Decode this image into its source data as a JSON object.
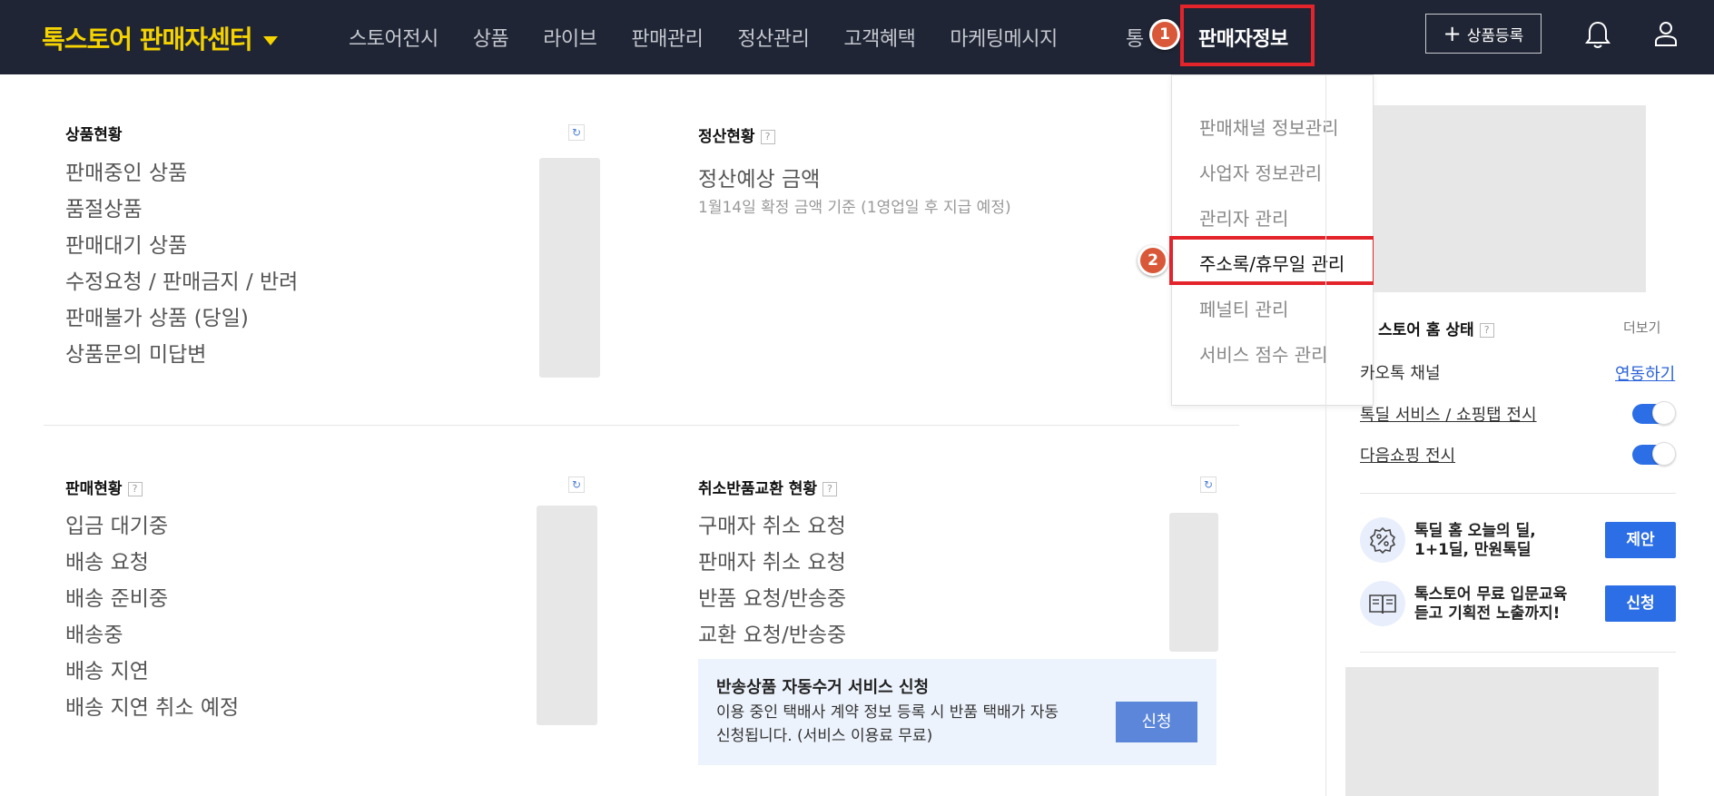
{
  "header": {
    "brand": "톡스토어 판매자센터",
    "nav_items": [
      "스토어전시",
      "상품",
      "라이브",
      "판매관리",
      "정산관리",
      "고객혜택",
      "마케팅메시지"
    ],
    "nav_clipped": "통",
    "active_menu": "판매자정보",
    "register_button": "상품등록",
    "step_badges": [
      "1",
      "2"
    ]
  },
  "dropdown": {
    "items": [
      "판매채널 정보관리",
      "사업자 정보관리",
      "관리자 관리",
      "주소록/휴무일 관리",
      "페널티 관리",
      "서비스 점수 관리"
    ]
  },
  "product_status": {
    "title": "상품현황",
    "rows": [
      "판매중인 상품",
      "품절상품",
      "판매대기 상품",
      "수정요청 / 판매금지 / 반려",
      "판매불가 상품 (당일)",
      "상품문의 미답변"
    ]
  },
  "settlement_status": {
    "title": "정산현황",
    "expected_label": "정산예상 금액",
    "note": "1월14일 확정 금액 기준 (1영업일 후 지급 예정)"
  },
  "sales_status": {
    "title": "판매현황",
    "rows": [
      "입금 대기중",
      "배송 요청",
      "배송 준비중",
      "배송중",
      "배송 지연",
      "배송 지연 취소 예정"
    ]
  },
  "cancel_status": {
    "title": "취소반품교환 현황",
    "rows": [
      "구매자 취소 요청",
      "판매자 취소 요청",
      "반품 요청/반송중",
      "교환 요청/반송중"
    ]
  },
  "return_banner": {
    "title": "반송상품 자동수거 서비스 신청",
    "description": "이용 중인 택배사 계약 정보 등록 시 반품 택배가 자동 신청됩니다. (서비스 이용료 무료)",
    "button": "신청"
  },
  "store_home": {
    "title": "스토어 홈 상태",
    "more": "더보기",
    "kakao_label": "카오톡 채널",
    "kakao_action": "연동하기",
    "toggles": [
      {
        "label": "톡딜 서비스 / 쇼핑탭 전시",
        "on": true
      },
      {
        "label": "다음쇼핑 전시",
        "on": true
      }
    ]
  },
  "promos": [
    {
      "line1": "톡딜 홈 오늘의 딜,",
      "line2": "1+1딜, 만원톡딜",
      "button": "제안",
      "icon": "discount-icon"
    },
    {
      "line1": "톡스토어 무료 입문교육",
      "line2": "듣고 기획전 노출까지!",
      "button": "신청",
      "icon": "book-icon"
    }
  ],
  "colors": {
    "nav_bg": "#1f2534",
    "brand": "#f5d300",
    "highlight": "#e3242b",
    "badge": "#d9583a",
    "accent": "#2c6ee5"
  }
}
